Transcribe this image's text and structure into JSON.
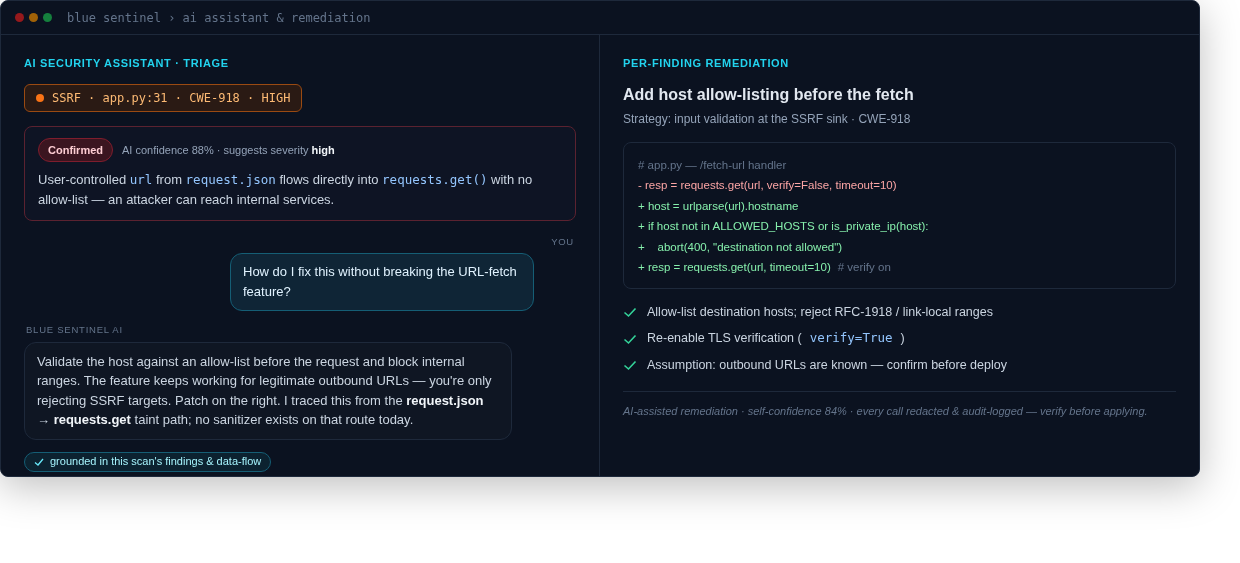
{
  "window": {
    "title": "blue sentinel › ai assistant & remediation"
  },
  "triage": {
    "heading": "AI SECURITY ASSISTANT · TRIAGE",
    "finding_chip": {
      "text": "SSRF · app.py:31 · CWE-918 · HIGH",
      "color": "#f97316"
    },
    "verdict": {
      "badge": "Confirmed",
      "confidence": "AI confidence 88% · suggests severity **high**",
      "description": [
        {
          "kind": "plain",
          "text": "User-controlled "
        },
        {
          "kind": "code",
          "text": "url"
        },
        {
          "kind": "plain",
          "text": " from "
        },
        {
          "kind": "code",
          "text": "request.json"
        },
        {
          "kind": "plain",
          "text": " flows directly into "
        },
        {
          "kind": "code",
          "text": "requests.get()"
        },
        {
          "kind": "plain",
          "text": " with no allow-list — an attacker can reach internal services."
        }
      ]
    },
    "messages": [
      {
        "kind": "user",
        "sender": "YOU",
        "text": "How do I fix this without breaking the URL-fetch feature?"
      },
      {
        "kind": "assistant",
        "sender": "BLUE SENTINEL AI",
        "text": "Validate the host against an allow-list before the request and block internal ranges. The feature keeps working for legitimate outbound URLs — you're only rejecting SSRF targets. Patch on the right. I traced this from the **request.json** → **requests.get** taint path; no sanitizer exists on that route today."
      }
    ],
    "grounding_badge": "grounded in this scan's findings & data-flow"
  },
  "remediation": {
    "heading": "PER-FINDING REMEDIATION",
    "title": "Add host allow-listing before the fetch",
    "strategy": "Strategy: input validation at the SSRF sink · CWE-918",
    "code_lines": [
      {
        "kind": "comment",
        "text": "# app.py — /fetch-url handler"
      },
      {
        "kind": "removed",
        "text": "- resp = requests.get(url, verify=False, timeout=10)"
      },
      {
        "kind": "added",
        "text": "+ host = urlparse(url).hostname"
      },
      {
        "kind": "added",
        "text": "+ if host not in ALLOWED_HOSTS or is_private_ip(host):"
      },
      {
        "kind": "added",
        "text": "+    abort(400, \"destination not allowed\")"
      },
      {
        "kind": "added",
        "text": "+ resp = requests.get(url, timeout=10)",
        "comment": "# verify on"
      }
    ],
    "checklist": [
      [
        {
          "kind": "plain",
          "text": "Allow-list destination hosts; reject RFC-1918 / link-local ranges"
        }
      ],
      [
        {
          "kind": "plain",
          "text": "Re-enable TLS verification ("
        },
        {
          "kind": "code",
          "text": "verify=True"
        },
        {
          "kind": "plain",
          "text": ")"
        }
      ],
      [
        {
          "kind": "plain",
          "text": "Assumption: outbound URLs are known — confirm before deploy"
        }
      ]
    ],
    "footnote": "AI-assisted remediation · self-confidence 84% · every call redacted & audit-logged — verify before applying."
  }
}
